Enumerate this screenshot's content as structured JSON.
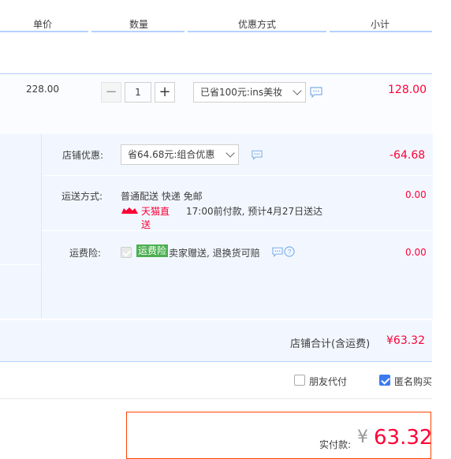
{
  "header": {
    "price": "单价",
    "qty": "数量",
    "discount": "优惠方式",
    "subtotal": "小计"
  },
  "product": {
    "unit_price": "228.00",
    "quantity": "1",
    "discount_select": "已省100元:ins美妆",
    "subtotal": "128.00"
  },
  "shop": {
    "discount_label": "店铺优惠:",
    "discount_select": "省64.68元:组合优惠",
    "discount_amount": "-64.68",
    "shipping_label": "运送方式:",
    "shipping_text": "普通配送 快递 免邮",
    "tmall_badge": "天猫直送",
    "delivery_text": "17:00前付款, 预计4月27日送达",
    "shipping_amount": "0.00",
    "insurance_label": "运费险:",
    "insurance_badge": "运费险",
    "insurance_text": "卖家赠送, 退换货可赔",
    "insurance_amount": "0.00"
  },
  "total": {
    "label": "店铺合计(含运费)",
    "amount": "¥63.32"
  },
  "options": {
    "friend_pay": "朋友代付",
    "anonymous": "匿名购买"
  },
  "payment": {
    "label": "实付款:",
    "currency": "¥",
    "amount": "63.32"
  },
  "colors": {
    "accent_red": "#ff4400",
    "accent_blue": "#3a7bf0",
    "light_blue_bg": "#f2f7ff",
    "insurance_green": "#4caf50",
    "tmall_red": "#ff0036"
  }
}
